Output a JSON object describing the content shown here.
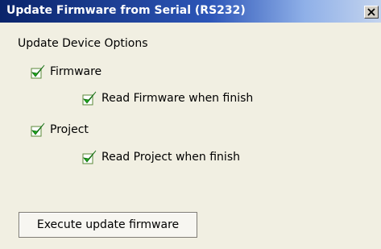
{
  "window": {
    "title": "Update Firmware from Serial (RS232)",
    "close_glyph": "X"
  },
  "section": {
    "title": "Update Device Options"
  },
  "options": [
    {
      "label": "Firmware",
      "checked": true
    },
    {
      "label": "Read Firmware when finish",
      "checked": true
    },
    {
      "label": "Project",
      "checked": true
    },
    {
      "label": "Read Project when finish",
      "checked": true
    }
  ],
  "actions": {
    "execute_label": "Execute update firmware"
  },
  "icons": {
    "checkbox": "checkmark-icon",
    "close": "close-icon"
  },
  "colors": {
    "title_bar": "#0a246a",
    "check_green": "#1fa81f",
    "window_bg": "#f1efe2"
  }
}
